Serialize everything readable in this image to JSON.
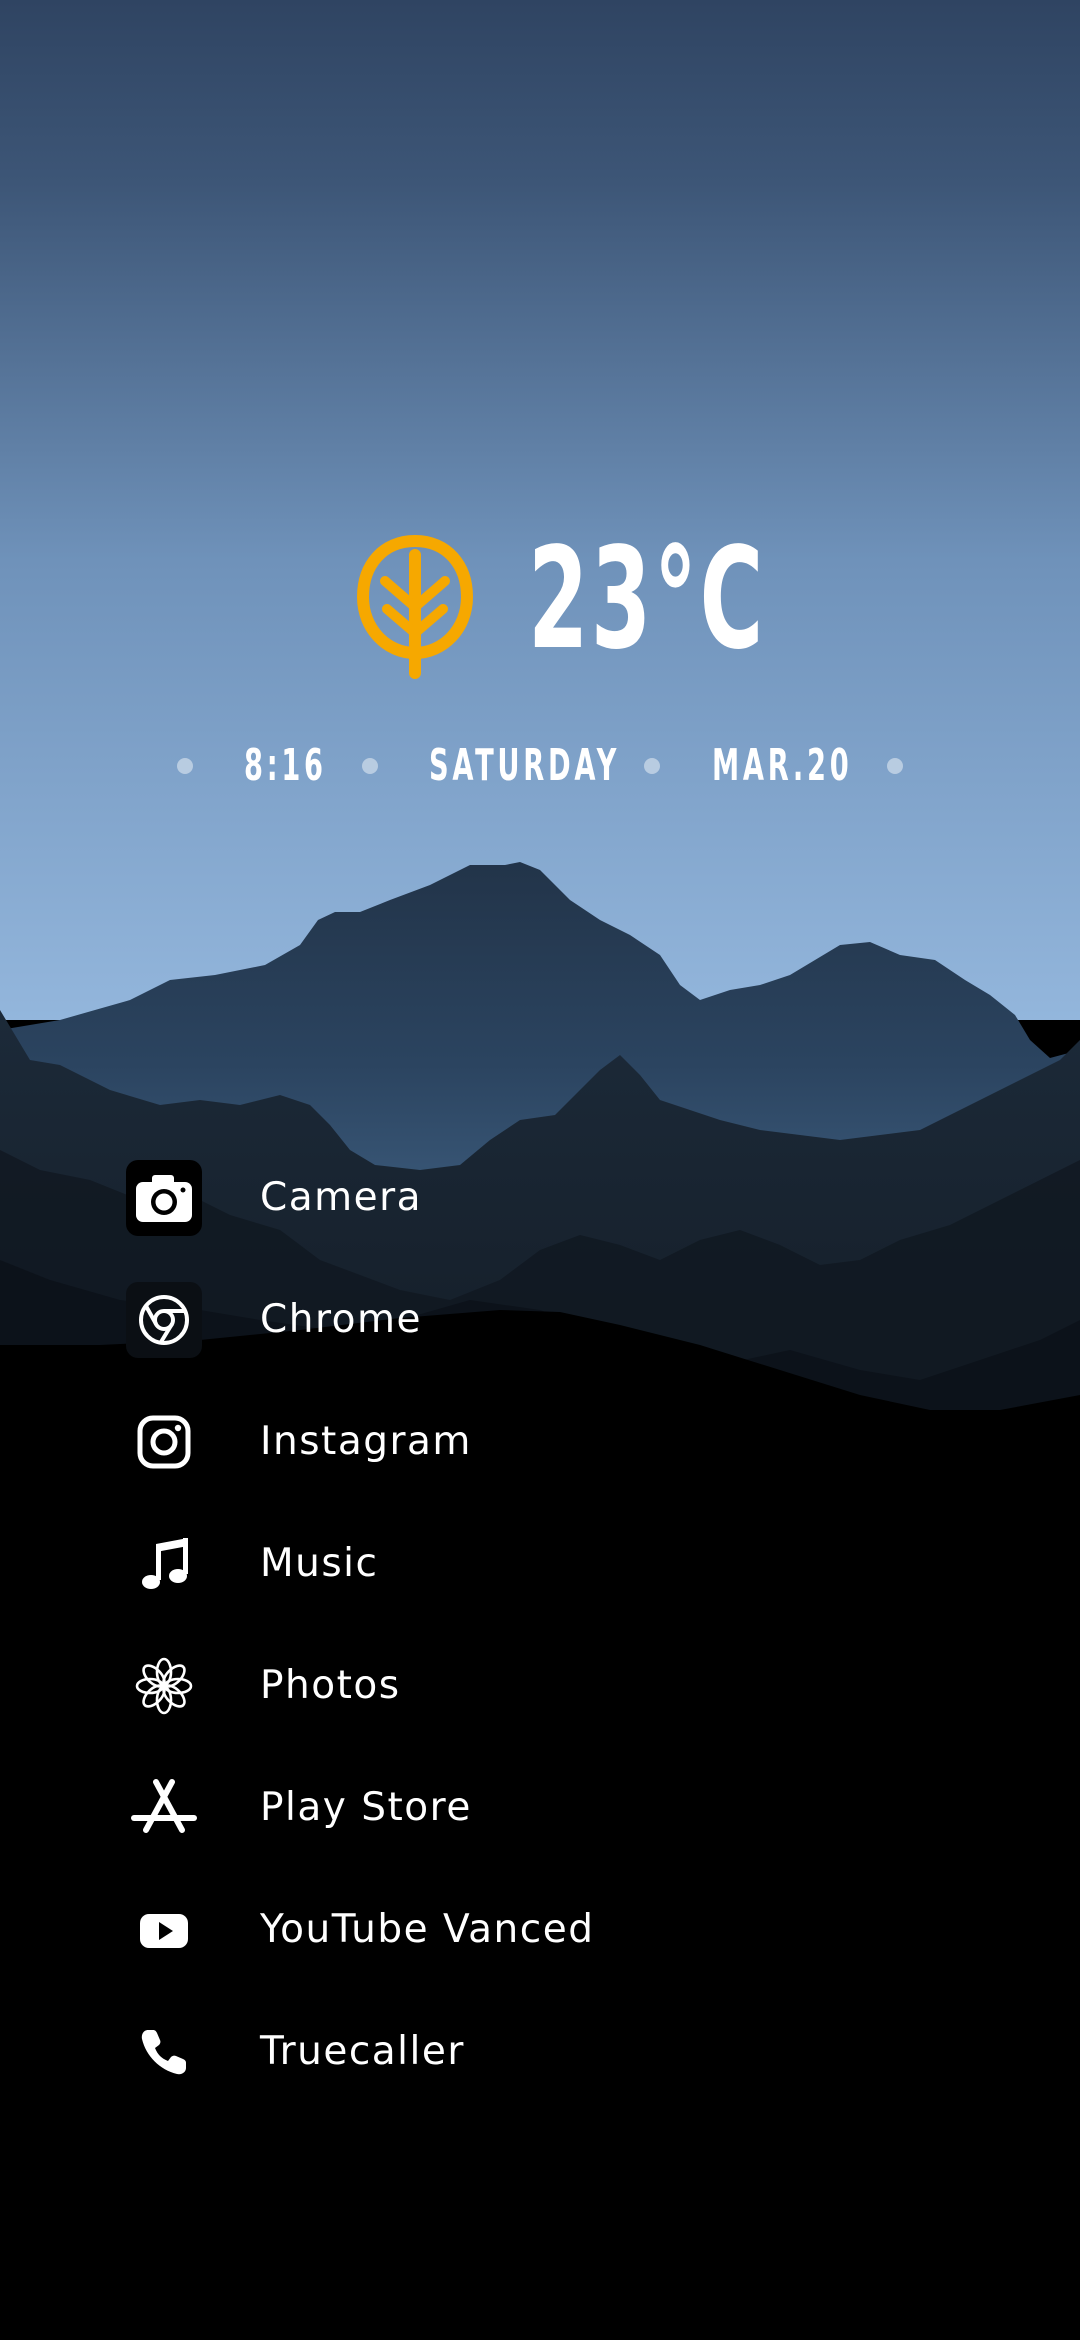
{
  "weather": {
    "temperature": "23°C",
    "icon": "leaf-icon",
    "accent_color": "#F6A800"
  },
  "info": {
    "time": "8:16",
    "day": "SATURDAY",
    "date": "MAR.20"
  },
  "apps": [
    {
      "label": "Camera",
      "icon": "camera-icon"
    },
    {
      "label": "Chrome",
      "icon": "chrome-icon"
    },
    {
      "label": "Instagram",
      "icon": "instagram-icon"
    },
    {
      "label": "Music",
      "icon": "music-note-icon"
    },
    {
      "label": "Photos",
      "icon": "photos-flower-icon"
    },
    {
      "label": "Play Store",
      "icon": "app-store-icon"
    },
    {
      "label": "YouTube Vanced",
      "icon": "youtube-icon"
    },
    {
      "label": "Truecaller",
      "icon": "phone-icon"
    }
  ]
}
